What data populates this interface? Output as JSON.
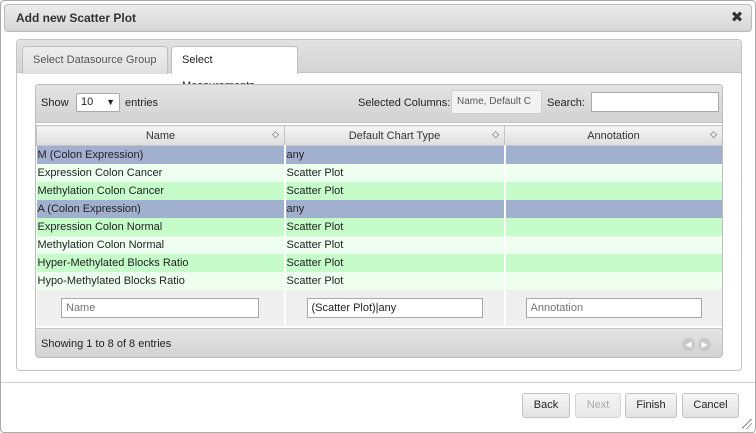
{
  "dialog": {
    "title": "Add new Scatter Plot",
    "close_icon": "close-icon",
    "close_glyph": "✖"
  },
  "tabs": [
    {
      "label": "Select Datasource Group",
      "active": false
    },
    {
      "label": "Select Measurements",
      "active": true
    }
  ],
  "toolbar": {
    "show_label": "Show",
    "show_value": "10",
    "entries_label": "entries",
    "selected_columns_label": "Selected Columns:",
    "selected_columns_value": "Name, Default C",
    "search_label": "Search:",
    "search_value": ""
  },
  "table": {
    "columns": [
      "Name",
      "Default Chart Type",
      "Annotation"
    ],
    "rows": [
      {
        "name": "M (Colon Expression)",
        "chart_type": "any",
        "annotation": "",
        "style": "sel"
      },
      {
        "name": "Expression Colon Cancer",
        "chart_type": "Scatter Plot",
        "annotation": "",
        "style": "light"
      },
      {
        "name": "Methylation Colon Cancer",
        "chart_type": "Scatter Plot",
        "annotation": "",
        "style": "green"
      },
      {
        "name": "A (Colon Expression)",
        "chart_type": "any",
        "annotation": "",
        "style": "sel"
      },
      {
        "name": "Expression Colon Normal",
        "chart_type": "Scatter Plot",
        "annotation": "",
        "style": "green"
      },
      {
        "name": "Methylation Colon Normal",
        "chart_type": "Scatter Plot",
        "annotation": "",
        "style": "light"
      },
      {
        "name": "Hyper-Methylated Blocks Ratio",
        "chart_type": "Scatter Plot",
        "annotation": "",
        "style": "green"
      },
      {
        "name": "Hypo-Methylated Blocks Ratio",
        "chart_type": "Scatter Plot",
        "annotation": "",
        "style": "light"
      }
    ],
    "filters": {
      "name_placeholder": "Name",
      "chart_type_value": "(Scatter Plot)|any",
      "annotation_placeholder": "Annotation"
    }
  },
  "footer": {
    "info": "Showing 1 to 8 of 8 entries"
  },
  "buttons": {
    "back": "Back",
    "next": "Next",
    "finish": "Finish",
    "cancel": "Cancel"
  },
  "colors": {
    "selected_row": "#a2b0d0",
    "light_row": "#eefff0",
    "green_row": "#c5fcc9"
  }
}
